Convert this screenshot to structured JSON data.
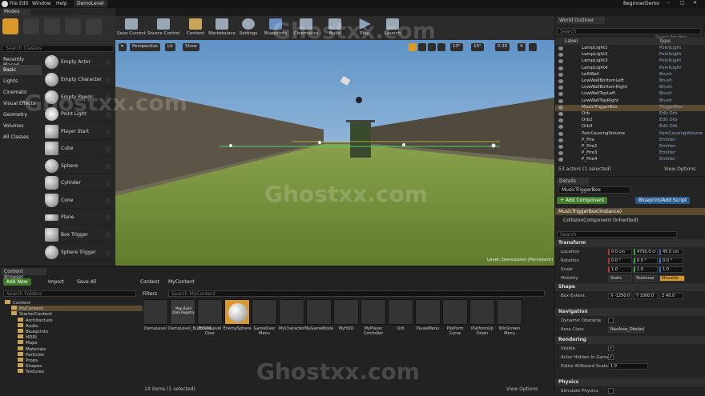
{
  "title_tab": "DemoLevel",
  "project_name": "BeginnerDemo",
  "menu": [
    "File",
    "Edit",
    "Window",
    "Help"
  ],
  "modes": {
    "tab_label": "Modes",
    "search_placeholder": "Search Classes",
    "categories": [
      "Recently Placed",
      "Basic",
      "Lights",
      "Cinematic",
      "Visual Effects",
      "Geometry",
      "Volumes",
      "All Classes"
    ],
    "selected_category": "Basic",
    "items": [
      "Empty Actor",
      "Empty Character",
      "Empty Pawn",
      "Point Light",
      "Player Start",
      "Cube",
      "Sphere",
      "Cylinder",
      "Cone",
      "Plane",
      "Box Trigger",
      "Sphere Trigger"
    ]
  },
  "toolbar": [
    "Save Current",
    "Source Control",
    "Content",
    "Marketplace",
    "Settings",
    "Blueprints",
    "Cinematics",
    "Build",
    "Play",
    "Launch"
  ],
  "viewport": {
    "perspective": "Perspective",
    "lit": "Lit",
    "show": "Show",
    "grid": "10°",
    "angle": "10°",
    "scale": "0.25",
    "camera_speed": "4",
    "level_label": "Level: DemoLevel (Persistent)"
  },
  "outliner": {
    "tab_label": "World Outliner",
    "search_placeholder": "Search",
    "help_link": "Search For Help",
    "col_label": "Label",
    "col_type": "Type",
    "rows": [
      {
        "name": "LampLight1",
        "type": "PointLight"
      },
      {
        "name": "LampLight2",
        "type": "PointLight"
      },
      {
        "name": "LampLight3",
        "type": "PointLight"
      },
      {
        "name": "LampLight4",
        "type": "PointLight"
      },
      {
        "name": "LeftWall",
        "type": "Brush"
      },
      {
        "name": "LowWallBottomLeft",
        "type": "Brush"
      },
      {
        "name": "LowWallBottomRight",
        "type": "Brush"
      },
      {
        "name": "LowWallTopLeft",
        "type": "Brush"
      },
      {
        "name": "LowWallTopRight",
        "type": "Brush"
      },
      {
        "name": "MusicTriggerBox",
        "type": "TriggerBox"
      },
      {
        "name": "Orb",
        "type": "Edit Orb"
      },
      {
        "name": "Orb2",
        "type": "Edit Orb"
      },
      {
        "name": "Orb3",
        "type": "Edit Orb"
      },
      {
        "name": "PainCausingVolume",
        "type": "PainCausingVolume"
      },
      {
        "name": "P_Fire",
        "type": "Emitter"
      },
      {
        "name": "P_Fire2",
        "type": "Emitter"
      },
      {
        "name": "P_Fire3",
        "type": "Emitter"
      },
      {
        "name": "P_Fire4",
        "type": "Emitter"
      }
    ],
    "selected": "MusicTriggerBox",
    "actors_count": "53 actors (1 selected)",
    "view_options": "View Options"
  },
  "details": {
    "tab_label": "Details",
    "name_value": "MusicTriggerBox",
    "add_component": "+ Add Component",
    "blueprint_script": "Blueprint/Add Script",
    "component_instance": "MusicTriggerBox(Instance)",
    "collision_component": "CollisionComponent (Inherited)",
    "search_placeholder": "Search",
    "transform_header": "Transform",
    "location_label": "Location",
    "location": [
      "0.0 cm",
      "4750.0 cr",
      "45.0 cm"
    ],
    "rotation_label": "Rotation",
    "rotation": [
      "0.0 °",
      "0.0 °",
      "0.0 °"
    ],
    "scale_label": "Scale",
    "scale": [
      "1.0",
      "1.0",
      "1.0"
    ],
    "mobility_label": "Mobility",
    "mobility_options": [
      "Static",
      "Stationar",
      "Movable"
    ],
    "shape_header": "Shape",
    "box_extent_label": "Box Extent",
    "box_extent": [
      "X -1250.0",
      "Y 1000.0",
      "Z 40.0"
    ],
    "navigation_header": "Navigation",
    "dynamic_obstacle_label": "Dynamic Obstacle",
    "area_class_label": "Area Class",
    "area_class_value": "NavArea_Obstacle",
    "rendering_header": "Rendering",
    "visible_label": "Visible",
    "actor_hidden_label": "Actor Hidden In Game",
    "billboard_label": "Editor Billboard Scale",
    "billboard_value": "1.0",
    "physics_header": "Physics",
    "simulate_label": "Simulate Physics"
  },
  "content_browser": {
    "tab_label": "Content Browser",
    "add_new": "Add New",
    "import": "Import",
    "save_all": "Save All",
    "path": [
      "Content",
      "MyContent"
    ],
    "search_folders": "Search Folders",
    "filters": "Filters",
    "search_assets": "Search MyContent",
    "tree": [
      "Content",
      "MyContent",
      "StarterContent",
      "Architecture",
      "Audio",
      "Blueprints",
      "HDRI",
      "Maps",
      "Materials",
      "Particles",
      "Props",
      "Shapes",
      "Textures"
    ],
    "assets": [
      "DemoLevel",
      "DemoLevel_BuiltData",
      "ExitOfLevel Door",
      "EnemySphere",
      "GameOver Menu",
      "MyCharacter",
      "MyGameMode",
      "MyHUD",
      "MyPlayer Controller",
      "Orb",
      "PauseMenu",
      "Platform Curve",
      "PlatformUp Down",
      "WinScreen Menu"
    ],
    "build_data_badge": "Map Build Data Registry",
    "items_count": "14 items (1 selected)",
    "view_options": "View Options"
  },
  "watermark": "Ghostxx.com",
  "colors": {
    "accent": "#d99a2b",
    "selection": "#5a4a30",
    "green": "#3f7d2a",
    "blue": "#2a5b8d"
  }
}
